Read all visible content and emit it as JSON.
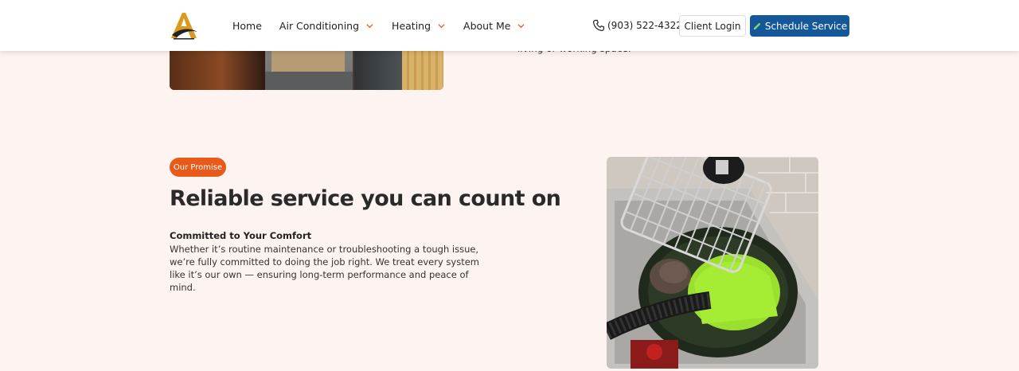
{
  "header": {
    "logo_icon": "letter-a-logo-icon",
    "nav": [
      {
        "label": "Home",
        "has_dropdown": false
      },
      {
        "label": "Air Conditioning",
        "has_dropdown": true
      },
      {
        "label": "Heating",
        "has_dropdown": true
      },
      {
        "label": "About Me",
        "has_dropdown": true
      }
    ],
    "phone": {
      "icon": "phone-icon",
      "number": "(903) 522-4322"
    },
    "client_login_label": "Client Login",
    "schedule": {
      "icon": "pencil-icon",
      "label": "Schedule Service"
    }
  },
  "top_section": {
    "text": "living or working space."
  },
  "promise": {
    "badge": "Our Promise",
    "headline": "Reliable service you can count on",
    "subheading": "Committed to Your Comfort",
    "body": "Whether it’s routine maintenance or troubleshooting a tough issue, we’re fully committed to doing the job right. We treat every system like it’s our own — ensuring long-term performance and peace of mind."
  },
  "colors": {
    "background": "#fdf3f0",
    "badge": "#e85a1a",
    "primary_button": "#14589a",
    "logo_gold": "#d99a1e"
  }
}
